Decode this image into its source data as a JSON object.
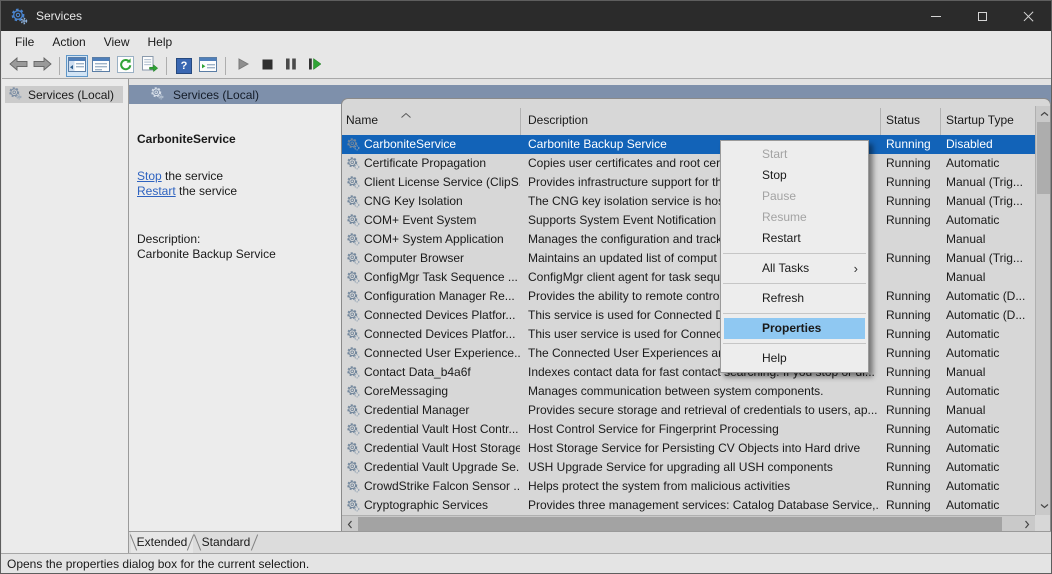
{
  "window": {
    "title": "Services"
  },
  "colors": {
    "titlebar": "#2b2b2b",
    "band": "#7e90ab",
    "selection": "#1263b8",
    "menu_highlight": "#8fc8f2",
    "link": "#2e63c0"
  },
  "menu_bar": {
    "items": [
      "File",
      "Action",
      "View",
      "Help"
    ]
  },
  "toolbar": {
    "buttons": [
      {
        "icon": "back-arrow-icon"
      },
      {
        "icon": "forward-arrow-icon"
      },
      {
        "sep": true,
        "icon": "show-console-tree-icon",
        "toggled": true
      },
      {
        "icon": "properties-window-icon"
      },
      {
        "icon": "refresh-icon"
      },
      {
        "icon": "export-list-icon"
      },
      {
        "sep": true,
        "icon": "help-icon"
      },
      {
        "icon": "show-action-pane-icon"
      },
      {
        "sep": true,
        "icon": "start-service-icon"
      },
      {
        "icon": "stop-service-icon"
      },
      {
        "icon": "pause-service-icon"
      },
      {
        "icon": "restart-service-icon"
      }
    ]
  },
  "tree": {
    "root_label": "Services (Local)"
  },
  "panel_header": {
    "label": "Services (Local)"
  },
  "extended_pane": {
    "service_name": "CarboniteService",
    "stop_link": "Stop",
    "stop_rest": " the service",
    "restart_link": "Restart",
    "restart_rest": " the service",
    "description_label": "Description:",
    "description": "Carbonite Backup Service"
  },
  "list": {
    "columns": [
      "Name",
      "Description",
      "Status",
      "Startup Type"
    ],
    "sorted_column": "Name",
    "rows": [
      {
        "name": "CarboniteService",
        "description": "Carbonite Backup Service",
        "status": "Running",
        "startup": "Disabled",
        "selected": true
      },
      {
        "name": "Certificate Propagation",
        "description": "Copies user certificates and root cert",
        "status": "Running",
        "startup": "Automatic"
      },
      {
        "name": "Client License Service (ClipS...",
        "description": "Provides infrastructure support for th",
        "status": "Running",
        "startup": "Manual (Trig..."
      },
      {
        "name": "CNG Key Isolation",
        "description": "The CNG key isolation service is host",
        "status": "Running",
        "startup": "Manual (Trig..."
      },
      {
        "name": "COM+ Event System",
        "description": "Supports System Event Notification S",
        "status": "Running",
        "startup": "Automatic"
      },
      {
        "name": "COM+ System Application",
        "description": "Manages the configuration and track",
        "status": "",
        "startup": "Manual"
      },
      {
        "name": "Computer Browser",
        "description": "Maintains an updated list of comput",
        "status": "Running",
        "startup": "Manual (Trig..."
      },
      {
        "name": "ConfigMgr Task Sequence ...",
        "description": "ConfigMgr client agent for task sequ",
        "status": "",
        "startup": "Manual"
      },
      {
        "name": "Configuration Manager Re...",
        "description": "Provides the ability to remote contro",
        "status": "Running",
        "startup": "Automatic (D..."
      },
      {
        "name": "Connected Devices Platfor...",
        "description": "This service is used for Connected De",
        "status": "Running",
        "startup": "Automatic (D..."
      },
      {
        "name": "Connected Devices Platfor...",
        "description": "This user service is used for Connect",
        "status": "Running",
        "startup": "Automatic"
      },
      {
        "name": "Connected User Experience...",
        "description": "The Connected User Experiences and",
        "status": "Running",
        "startup": "Automatic"
      },
      {
        "name": "Contact Data_b4a6f",
        "description": "Indexes contact data for fast contact searching. If you stop or di...",
        "status": "Running",
        "startup": "Manual"
      },
      {
        "name": "CoreMessaging",
        "description": "Manages communication between system components.",
        "status": "Running",
        "startup": "Automatic"
      },
      {
        "name": "Credential Manager",
        "description": "Provides secure storage and retrieval of credentials to users, ap...",
        "status": "Running",
        "startup": "Manual"
      },
      {
        "name": "Credential Vault Host Contr...",
        "description": "Host Control Service for Fingerprint Processing",
        "status": "Running",
        "startup": "Automatic"
      },
      {
        "name": "Credential Vault Host Storage",
        "description": "Host Storage Service for Persisting CV Objects into Hard drive",
        "status": "Running",
        "startup": "Automatic"
      },
      {
        "name": "Credential Vault Upgrade Se...",
        "description": "USH Upgrade Service for upgrading all USH components",
        "status": "Running",
        "startup": "Automatic"
      },
      {
        "name": "CrowdStrike Falcon Sensor ...",
        "description": "Helps protect the system from malicious activities",
        "status": "Running",
        "startup": "Automatic"
      },
      {
        "name": "Cryptographic Services",
        "description": "Provides three management services: Catalog Database Service,...",
        "status": "Running",
        "startup": "Automatic"
      }
    ]
  },
  "context_menu": {
    "items": [
      {
        "label": "Start",
        "disabled": true
      },
      {
        "label": "Stop",
        "disabled": false
      },
      {
        "label": "Pause",
        "disabled": true
      },
      {
        "label": "Resume",
        "disabled": true
      },
      {
        "label": "Restart",
        "disabled": false
      },
      {
        "separator": true
      },
      {
        "label": "All Tasks",
        "disabled": false,
        "submenu": true
      },
      {
        "separator": true
      },
      {
        "label": "Refresh",
        "disabled": false
      },
      {
        "separator": true
      },
      {
        "label": "Properties",
        "disabled": false,
        "highlighted": true
      },
      {
        "separator": true
      },
      {
        "label": "Help",
        "disabled": false
      }
    ],
    "submenu_arrow": "›"
  },
  "tabs": [
    "Extended",
    "Standard"
  ],
  "status_bar": {
    "text": "Opens the properties dialog box for the current selection."
  }
}
